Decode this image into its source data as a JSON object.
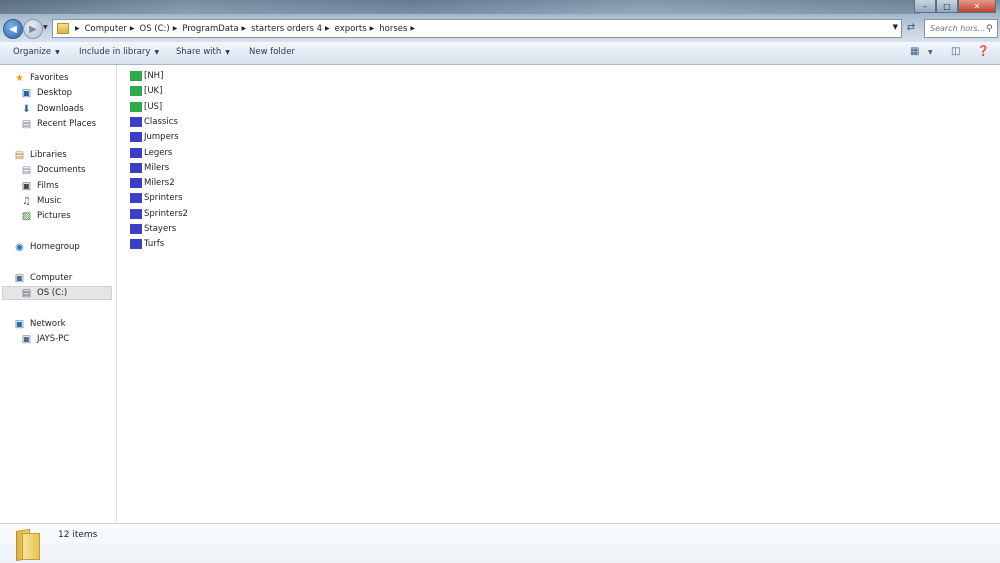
{
  "address": {
    "crumbs": [
      "Computer",
      "OS (C:)",
      "ProgramData",
      "starters orders 4",
      "exports",
      "horses"
    ]
  },
  "search": {
    "placeholder": "Search hors..."
  },
  "toolbar": {
    "organize": "Organize",
    "include_in_library": "Include in library",
    "share_with": "Share with",
    "new_folder": "New folder"
  },
  "nav": {
    "favorites": "Favorites",
    "desktop": "Desktop",
    "downloads": "Downloads",
    "recent_places": "Recent Places",
    "libraries": "Libraries",
    "documents": "Documents",
    "films": "Films",
    "music": "Music",
    "pictures": "Pictures",
    "homegroup": "Homegroup",
    "computer": "Computer",
    "os_c": "OS (C:)",
    "network": "Network",
    "jays_pc": "JAYS-PC"
  },
  "files": [
    {
      "name": "[NH]",
      "color": "#2eaa4a"
    },
    {
      "name": "[UK]",
      "color": "#2eaa4a"
    },
    {
      "name": "[US]",
      "color": "#2eaa4a"
    },
    {
      "name": "Classics",
      "color": "#3b3fc4"
    },
    {
      "name": "Jumpers",
      "color": "#3b3fc4"
    },
    {
      "name": "Legers",
      "color": "#3b3fc4"
    },
    {
      "name": "Milers",
      "color": "#3b3fc4"
    },
    {
      "name": "Milers2",
      "color": "#3b3fc4"
    },
    {
      "name": "Sprinters",
      "color": "#3b3fc4"
    },
    {
      "name": "Sprinters2",
      "color": "#3b3fc4"
    },
    {
      "name": "Stayers",
      "color": "#3b3fc4"
    },
    {
      "name": "Turfs",
      "color": "#3b3fc4"
    }
  ],
  "status": {
    "item_count": "12 items"
  }
}
